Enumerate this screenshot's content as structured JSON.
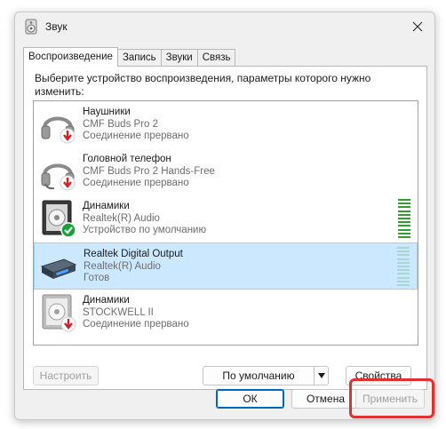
{
  "window": {
    "title": "Звук"
  },
  "tabs": [
    {
      "label": "Воспроизведение",
      "active": true
    },
    {
      "label": "Запись",
      "active": false
    },
    {
      "label": "Звуки",
      "active": false
    },
    {
      "label": "Связь",
      "active": false
    }
  ],
  "instruction": "Выберите устройство воспроизведения, параметры которого нужно изменить:",
  "devices": [
    {
      "name": "Наушники",
      "model": "CMF Buds Pro 2",
      "status": "Соединение прервано",
      "icon": "headphones-icon",
      "badge": "disconnected-badge-icon",
      "selected": false
    },
    {
      "name": "Головной телефон",
      "model": "CMF Buds Pro 2 Hands-Free",
      "status": "Соединение прервано",
      "icon": "headset-icon",
      "badge": "disconnected-badge-icon",
      "selected": false
    },
    {
      "name": "Динамики",
      "model": "Realtek(R) Audio",
      "status": "Устройство по умолчанию",
      "icon": "speaker-icon",
      "badge": "default-check-badge-icon",
      "selected": false
    },
    {
      "name": "Realtek Digital Output",
      "model": "Realtek(R) Audio",
      "status": "Готов",
      "icon": "digital-output-icon",
      "selected": true
    },
    {
      "name": "Динамики",
      "model": "STOCKWELL II",
      "status": "Соединение прервано",
      "icon": "speaker-icon",
      "badge": "disconnected-badge-icon",
      "selected": false
    }
  ],
  "buttons": {
    "configure": "Настроить",
    "default": "По умолчанию",
    "properties": "Свойства",
    "ok": "ОК",
    "cancel": "Отмена",
    "apply": "Применить"
  },
  "colors": {
    "accent": "#0067c0",
    "selection": "#cce8ff",
    "level_active": "#2fa02f",
    "level_idle": "#a9d6d3",
    "disconnected": "#d42020",
    "default_check": "#18a03a",
    "highlight": "#e03030"
  }
}
